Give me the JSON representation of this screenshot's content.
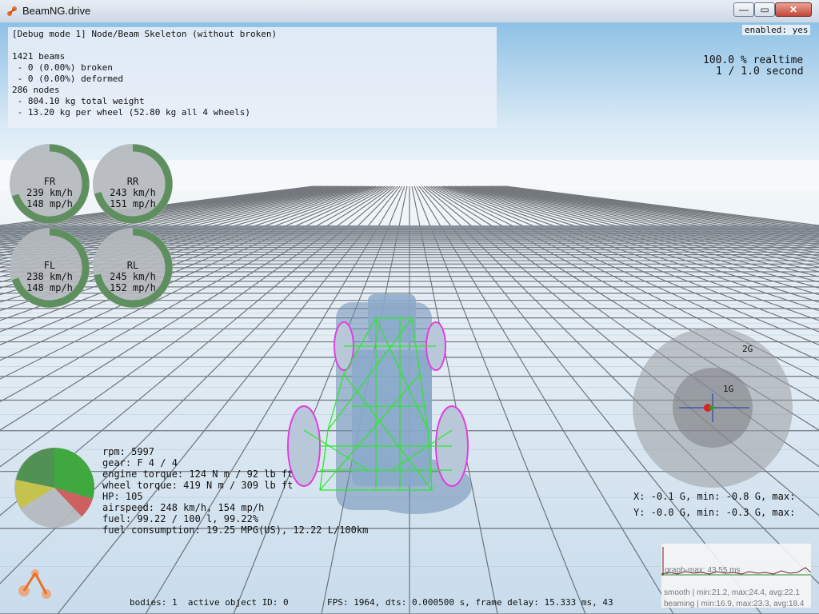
{
  "window": {
    "title": "BeamNG.drive",
    "minimize_label": "—",
    "maximize_label": "▭",
    "close_label": "✕"
  },
  "debug": {
    "mode_line": "[Debug mode 1] Node/Beam Skeleton (without broken)",
    "beams": "1421 beams",
    "broken": " - 0 (0.00%) broken",
    "deformed": " - 0 (0.00%) deformed",
    "nodes": "286 nodes",
    "weight": " - 804.10 kg total weight",
    "per_wheel": " - 13.20 kg per wheel (52.80 kg all 4 wheels)"
  },
  "status": {
    "enabled": "enabled: yes",
    "realtime": "100.0 % realtime",
    "second": "1 / 1.0 second"
  },
  "wheels": {
    "fr": {
      "name": "FR",
      "kmh": "239 km/h",
      "mph": "148 mp/h",
      "level": 0.7
    },
    "rr": {
      "name": "RR",
      "kmh": "243 km/h",
      "mph": "151 mp/h",
      "level": 0.71
    },
    "fl": {
      "name": "FL",
      "kmh": "238 km/h",
      "mph": "148 mp/h",
      "level": 0.7
    },
    "rl": {
      "name": "RL",
      "kmh": "245 km/h",
      "mph": "152 mp/h",
      "level": 0.72
    }
  },
  "engine": {
    "rpm": "rpm: 5997",
    "gear": "gear: F 4 / 4",
    "engine_torque": "engine torque: 124 N m / 92 lb ft",
    "wheel_torque": "wheel torque: 419 N m / 309 lb ft",
    "hp": "HP: 105",
    "airspeed": "airspeed: 248 km/h, 154 mp/h",
    "fuel": "fuel: 99.22 / 100 l, 99.22%",
    "consumption": "fuel consumption: 19.25 MPG(US), 12.22 L/100km"
  },
  "gforce": {
    "label_2g": "2G",
    "label_1g": "1G",
    "x_line": "X: -0.1 G, min: -0.8 G, max:",
    "y_line": "Y: -0.0 G, min: -0.3 G, max:"
  },
  "graph": {
    "max_label": "graph-max: 43.55 ms",
    "smooth": "smooth | min:21.2, max:24.4, avg:22.1",
    "beaming": "beaming | min:16.9, max:23.3, avg:18.4"
  },
  "bottom": {
    "bodies": "bodies: 1  active object ID: 0",
    "fps": "FPS: 1964, dts: 0.000500 s, frame delay: 15.333 ms, 43"
  },
  "colors": {
    "gauge_arc": "#5f8f5f",
    "beam_green": "#2ee82e",
    "node_magenta": "#e040e0",
    "g_dot": "#dd2222"
  }
}
